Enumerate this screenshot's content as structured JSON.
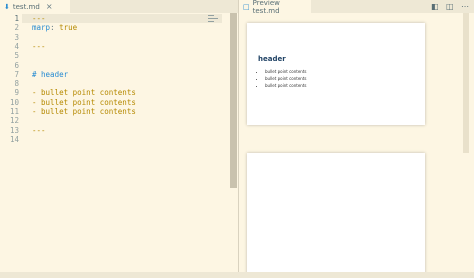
{
  "editor": {
    "tab_label": "test.md",
    "lines": [
      {
        "num": "1",
        "text": "---"
      },
      {
        "num": "2",
        "key": "marp",
        "sep": ": ",
        "value": "true"
      },
      {
        "num": "3",
        "text": ""
      },
      {
        "num": "4",
        "text": "---"
      },
      {
        "num": "5",
        "text": ""
      },
      {
        "num": "6",
        "text": ""
      },
      {
        "num": "7",
        "text": "# header"
      },
      {
        "num": "8",
        "text": ""
      },
      {
        "num": "9",
        "text": "- bullet point contents"
      },
      {
        "num": "10",
        "text": "- bullet point contents"
      },
      {
        "num": "11",
        "text": "- bullet point contents"
      },
      {
        "num": "12",
        "text": ""
      },
      {
        "num": "13",
        "text": "---"
      },
      {
        "num": "14",
        "text": ""
      }
    ]
  },
  "preview": {
    "tab_label": "Preview test.md",
    "slide1": {
      "heading": "header",
      "bullets": [
        "bullet point contents",
        "bullet point contents",
        "bullet point contents"
      ]
    }
  },
  "colors": {
    "background": "#fdf6e3",
    "accent": "#268bd2",
    "heading": "#224466"
  },
  "icons": [
    "markdown-icon",
    "close-icon",
    "open-source-icon",
    "split-editor-icon",
    "more-actions-icon"
  ]
}
